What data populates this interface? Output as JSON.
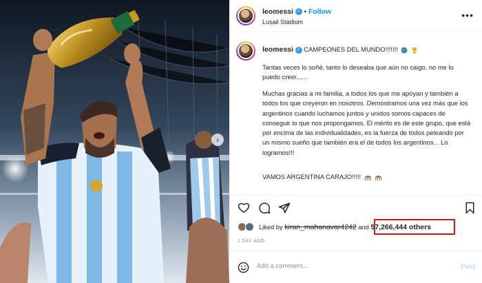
{
  "post": {
    "author": "leomessi",
    "follow_label": "Follow",
    "location": "Lusail Stadium",
    "caption_headline": "CAMPEONES DEL MUNDO!!!!!!!",
    "caption_paragraphs": [
      "Tantas veces lo soñé, tanto lo deseaba que aún no caigo, no me lo puedo creer......",
      "Muchas gracias a mi familia, a todos los que me apoyan y también a todos los que creyeron en nosotros. Demostramos una vez más que los argentinos cuando luchamos juntos y unidos somos capaces de conseguir lo que nos propongamos. El mérito es de este grupo, que está por encima de las individualidades, es la fuerza de todos peleando por un mismo sueño que también era el de todos los argentinos... Lo logramos!!!",
      "VAMOS ARGENTINA CARAJO!!!!!"
    ],
    "likes_prefix": "Liked by",
    "liked_by_user": "kiran_mahanavar4242",
    "likes_joiner": "and",
    "likes_count": "57,266,444 others",
    "timestamp": "1 DAY AGO"
  },
  "comment": {
    "placeholder": "Add a comment...",
    "post_label": "Post"
  },
  "icons": {
    "like": "heart-icon",
    "comment": "comment-icon",
    "share": "share-icon",
    "save": "bookmark-icon",
    "emoji": "smiley-icon",
    "more": "more-icon",
    "verified": "verified-badge-icon"
  },
  "colors": {
    "accent": "#0095f6",
    "highlight_box": "#d0181c",
    "muted": "#8e8e8e"
  }
}
